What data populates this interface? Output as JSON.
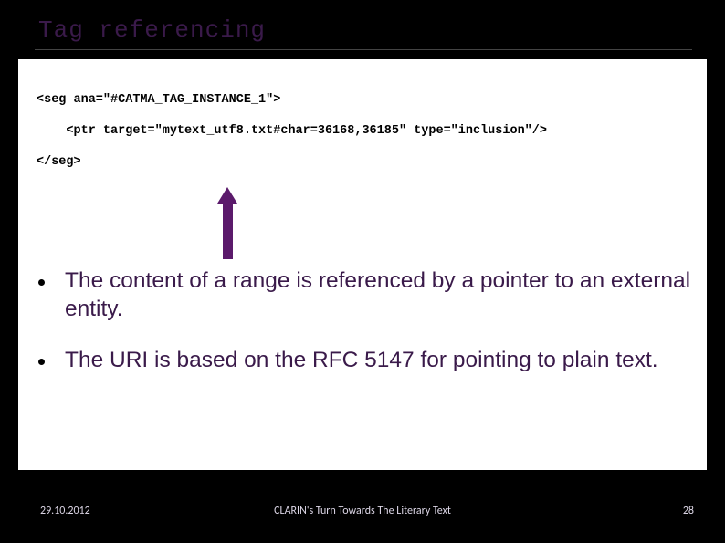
{
  "slide": {
    "title": "Tag referencing",
    "code": {
      "line1": "<seg ana=\"#CATMA_TAG_INSTANCE_1\">",
      "line2": "    <ptr target=\"mytext_utf8.txt#char=36168,36185\" type=\"inclusion\"/>",
      "line3": "</seg>"
    },
    "bullets": [
      "The content of a range is referenced by a pointer to an external entity.",
      "The URI is based on the RFC 5147 for pointing to plain text."
    ]
  },
  "footer": {
    "date": "29.10.2012",
    "title": "CLARIN's Turn Towards The Literary Text",
    "page": "28"
  },
  "colors": {
    "accent": "#5b1a6b",
    "heading": "#3a1a4a"
  }
}
